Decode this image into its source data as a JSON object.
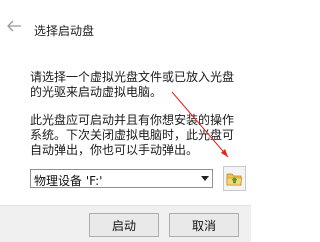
{
  "dialog": {
    "title": "选择启动盘",
    "paragraph1": "请选择一个虚拟光盘文件或已放入光盘的光驱来启动虚拟电脑。",
    "paragraph2": "此光盘应可启动并且有你想安装的操作系统。下次关闭虚拟电脑时，此光盘可自动弹出，你也可以手动弹出。"
  },
  "drive_select": {
    "value": "物理设备 'F:'"
  },
  "buttons": {
    "start": "启动",
    "cancel": "取消"
  },
  "icons": {
    "back": "back-arrow-icon",
    "dropdown": "dropdown-triangle-icon",
    "folder": "folder-with-green-arrow-icon"
  },
  "colors": {
    "annotation_arrow": "#e8211a",
    "folder_yellow": "#f2c14e",
    "folder_arrow_green": "#3fa33a"
  }
}
